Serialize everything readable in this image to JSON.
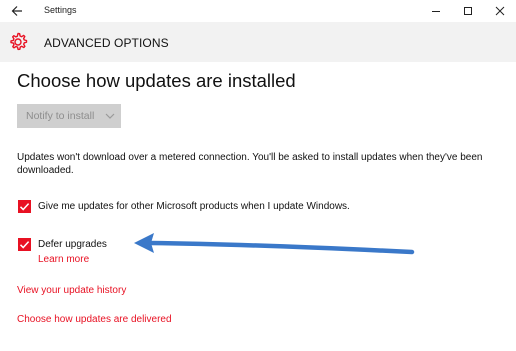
{
  "titlebar": {
    "title": "Settings",
    "back_icon": "arrow-left-icon",
    "controls": [
      "minimize-icon",
      "maximize-icon",
      "close-icon"
    ]
  },
  "header": {
    "title": "ADVANCED OPTIONS",
    "icon": "gear-icon",
    "accent": "#e81123"
  },
  "main": {
    "heading": "Choose how updates are installed",
    "dropdown": {
      "selected": "Notify to install",
      "disabled": true
    },
    "description": "Updates won't download over a metered connection. You'll be asked to install updates when they've been downloaded.",
    "options": [
      {
        "label": "Give me updates for other Microsoft products when I update Windows.",
        "checked": true
      },
      {
        "label": "Defer upgrades",
        "checked": true,
        "link": "Learn more"
      }
    ],
    "links": {
      "history": "View your update history",
      "delivery": "Choose how updates are delivered"
    }
  },
  "colors": {
    "accent_red": "#e81123",
    "header_bg": "#f2f2f2",
    "dropdown_bg": "#cfcfcf",
    "annotation_arrow": "#3a78c9"
  }
}
